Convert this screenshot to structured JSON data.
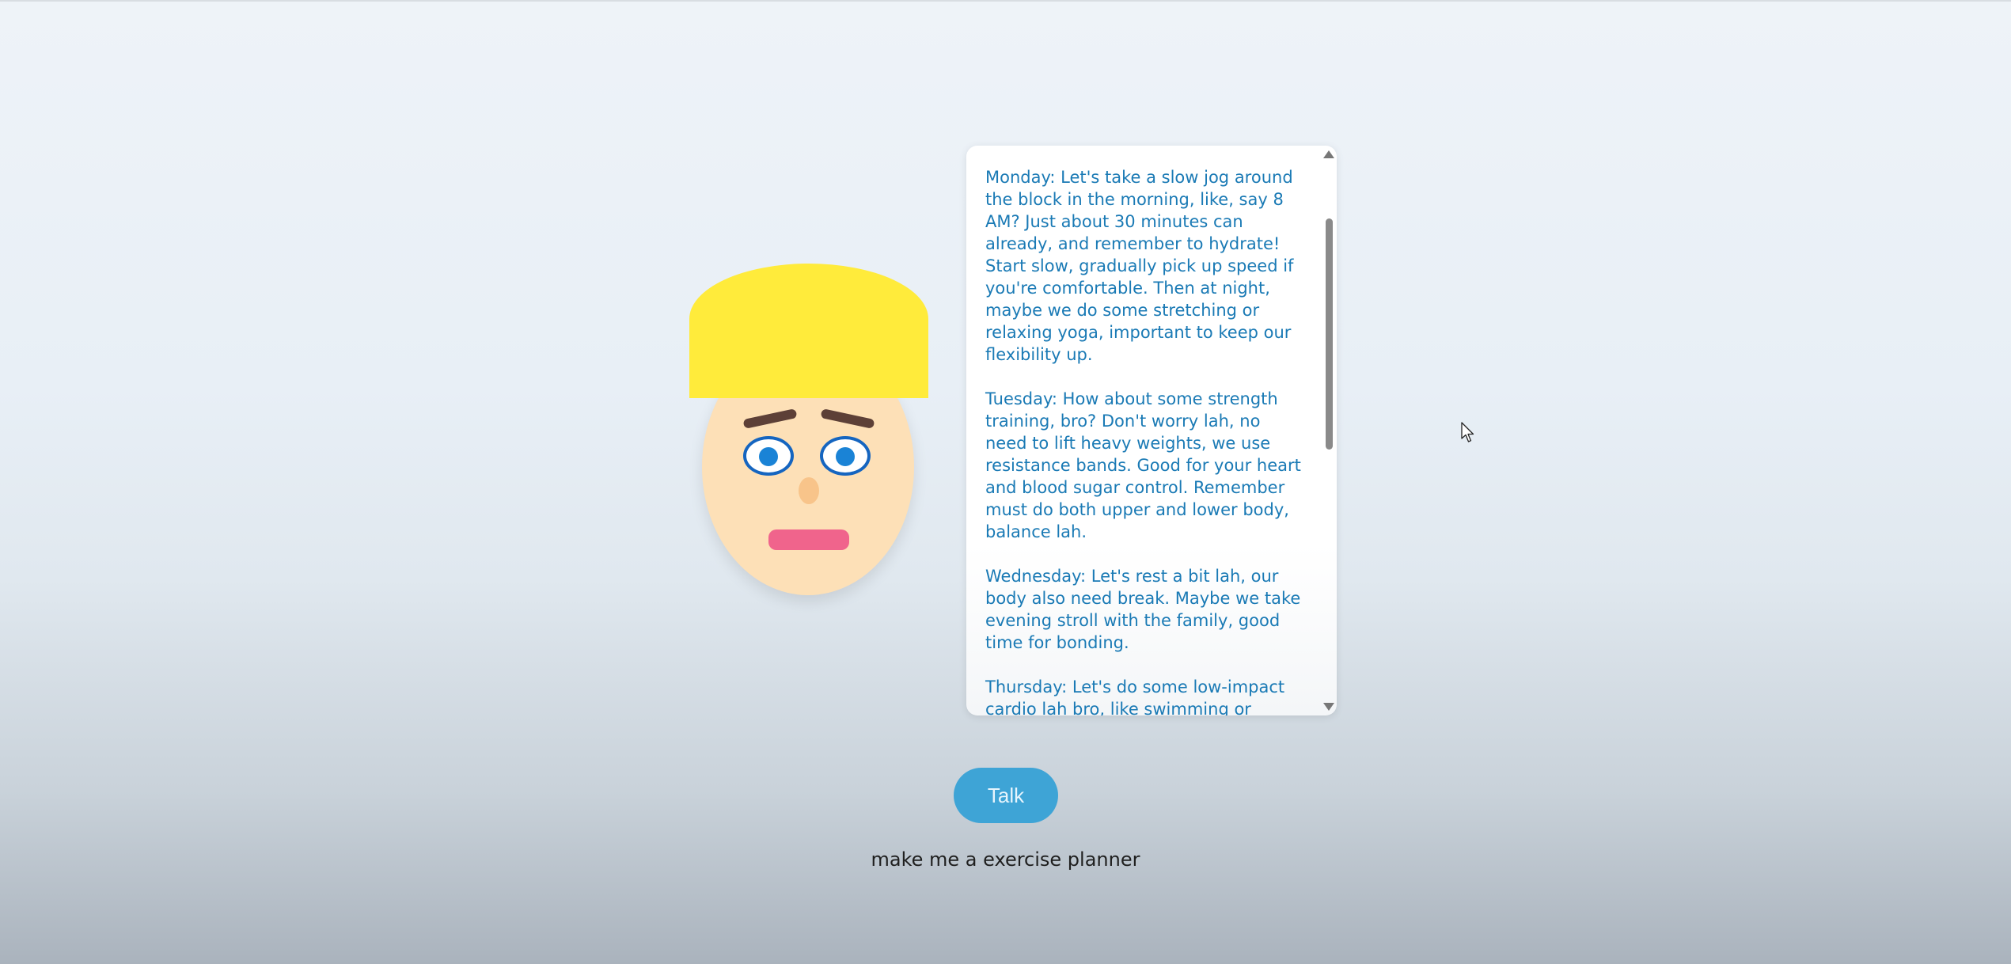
{
  "response_panel": {
    "paragraphs": [
      "Monday: Let's take a slow jog around the block in the morning, like, say 8 AM? Just about 30 minutes can already, and remember to hydrate! Start slow, gradually pick up speed if you're comfortable. Then at night, maybe we do some stretching or relaxing yoga, important to keep our flexibility up.",
      "Tuesday: How about some strength training, bro? Don't worry lah, no need to lift heavy weights, we use resistance bands. Good for your heart and blood sugar control. Remember must do both upper and lower body, balance lah.",
      "Wednesday: Let's rest a bit lah, our body also need break. Maybe we take evening stroll with the family, good time for bonding.",
      "Thursday: Let's do some low-impact cardio lah bro, like swimming or"
    ]
  },
  "talk_button": {
    "label": "Talk"
  },
  "prompt": {
    "text": "make me a exercise planner"
  },
  "colors": {
    "hair": "#ffeb3b",
    "skin": "#fde0b7",
    "response_text": "#1a7ab5",
    "button": "#3ea4d6"
  }
}
